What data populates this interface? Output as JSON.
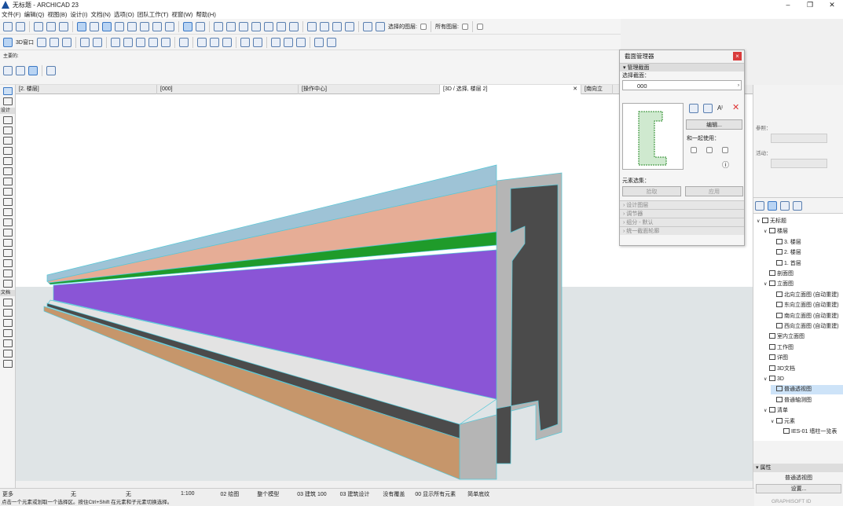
{
  "window": {
    "title": "无标题 - ARCHICAD 23",
    "minimize": "–",
    "restore": "❐",
    "close": "✕"
  },
  "menu": [
    "文件(F)",
    "编辑(Q)",
    "视图(B)",
    "设计(I)",
    "文档(N)",
    "选项(O)",
    "团队工作(T)",
    "视窗(W)",
    "帮助(H)"
  ],
  "toolbar": {
    "layer_filter_label": "选择的图层:",
    "all_layers_label": "所有图层:",
    "window3d_label": "3D窗口",
    "main_label": "主要的:"
  },
  "left_tools": {
    "design_label": "设计",
    "document_label": "文档",
    "more_label": "更多"
  },
  "tabs": [
    {
      "label": "[2. 楼层]"
    },
    {
      "label": "[000]"
    },
    {
      "label": "[操作中心]"
    },
    {
      "label": "[3D / 选择, 楼层 2]",
      "active": true,
      "close": "✕"
    },
    {
      "label": "[南向立"
    }
  ],
  "section_manager": {
    "title": "截面管理器",
    "close": "×",
    "manage_section": "▾ 管理截面",
    "select_section_label": "选择截面：",
    "selected_section": "000",
    "edit_button": "编辑...",
    "use_with_label": "和一起使用：",
    "element_selection_label": "元素选集：",
    "pick_button": "拾取",
    "apply_button": "应用",
    "sections": [
      "› 设计图层",
      "› 调节器",
      "› 组分 - 默认",
      "› 统一截面轮廓"
    ],
    "text_size": "Aᴵ"
  },
  "right_panel": {
    "reference_label": "参照：",
    "active_label": "活动：",
    "properties_label": "▾ 属性",
    "properties_value": "普通透视图",
    "settings_button": "设置...",
    "graphisoft": "GRAPHISOFT ID"
  },
  "navigator": [
    {
      "label": "无标题",
      "indent": 0,
      "caret": "∨"
    },
    {
      "label": "楼层",
      "indent": 1,
      "caret": "∨"
    },
    {
      "label": "3. 楼层",
      "indent": 2,
      "caret": ""
    },
    {
      "label": "2. 楼层",
      "indent": 2,
      "caret": ""
    },
    {
      "label": "1. 首层",
      "indent": 2,
      "caret": ""
    },
    {
      "label": "剖面图",
      "indent": 1,
      "caret": ""
    },
    {
      "label": "立面图",
      "indent": 1,
      "caret": "∨"
    },
    {
      "label": "北向立面图 (自动重建)",
      "indent": 2,
      "caret": ""
    },
    {
      "label": "东向立面图 (自动重建)",
      "indent": 2,
      "caret": ""
    },
    {
      "label": "南向立面图 (自动重建)",
      "indent": 2,
      "caret": ""
    },
    {
      "label": "西向立面图 (自动重建)",
      "indent": 2,
      "caret": ""
    },
    {
      "label": "室内立面图",
      "indent": 1,
      "caret": ""
    },
    {
      "label": "工作图",
      "indent": 1,
      "caret": ""
    },
    {
      "label": "详图",
      "indent": 1,
      "caret": ""
    },
    {
      "label": "3D文档",
      "indent": 1,
      "caret": ""
    },
    {
      "label": "3D",
      "indent": 1,
      "caret": "∨"
    },
    {
      "label": "普通透视图",
      "indent": 2,
      "caret": "",
      "selected": true
    },
    {
      "label": "普通轴测图",
      "indent": 2,
      "caret": ""
    },
    {
      "label": "清单",
      "indent": 1,
      "caret": "∨"
    },
    {
      "label": "元素",
      "indent": 2,
      "caret": "∨"
    },
    {
      "label": "IES-01 墙柱一览表",
      "indent": 3,
      "caret": ""
    }
  ],
  "status": {
    "none1": "无",
    "none2": "无",
    "scale": "1:100",
    "drawing": "02 绘图",
    "model": "整个模型",
    "structure": "03 建筑 100",
    "design": "03 建筑设计",
    "override": "没有覆盖",
    "show_all": "00 显示所有元素",
    "simple": "简单底纹",
    "more": "更多"
  },
  "hint": "点击一个元素或划取一个选择区。按住Ctrl+Shift 在元素和子元素切换选择。",
  "colors": {
    "accent": "#3b78c4",
    "top_face": "#9ec3d6",
    "salmon": "#e6ad96",
    "green": "#1f9b2a",
    "purple": "#8a55d6",
    "tan": "#c6966b",
    "concrete": "#b5b5b5",
    "dark_concrete": "#4b4b4b",
    "sky": "#ffffff",
    "ground": "#dfe4e6"
  }
}
